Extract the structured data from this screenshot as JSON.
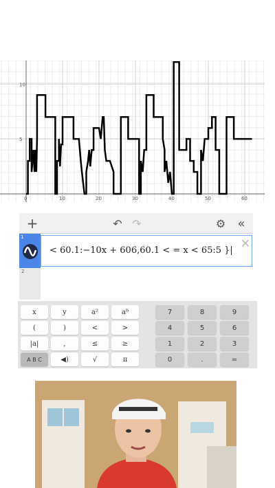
{
  "graph": {
    "x_ticks": [
      "0",
      "10",
      "20",
      "30",
      "40",
      "50",
      "60"
    ],
    "y_ticks": [
      "10",
      "5"
    ]
  },
  "toolbar": {
    "add_icon": "plus-icon",
    "undo_icon": "undo-icon",
    "redo_icon": "redo-icon",
    "settings_icon": "gear-icon",
    "collapse_icon": "double-chevron-left-icon"
  },
  "expressions": {
    "rows": [
      {
        "number": "1",
        "text": "< 60.1:−10x + 606,60.1 < = x < 65:5 }|",
        "color": "#4a86e8"
      },
      {
        "number": "2",
        "text": ""
      }
    ]
  },
  "keypad": {
    "left_keys": [
      "x",
      "y",
      "a²",
      "aᵇ",
      "(",
      ")",
      "<",
      ">",
      "|a|",
      ",",
      "≤",
      "≥",
      "A B C",
      "◀)",
      "√",
      "π"
    ],
    "number_keys": [
      "7",
      "8",
      "9",
      "4",
      "5",
      "6",
      "1",
      "2",
      "3",
      "0",
      ".",
      "="
    ]
  },
  "video": {
    "description_icon": "webcam-person"
  }
}
